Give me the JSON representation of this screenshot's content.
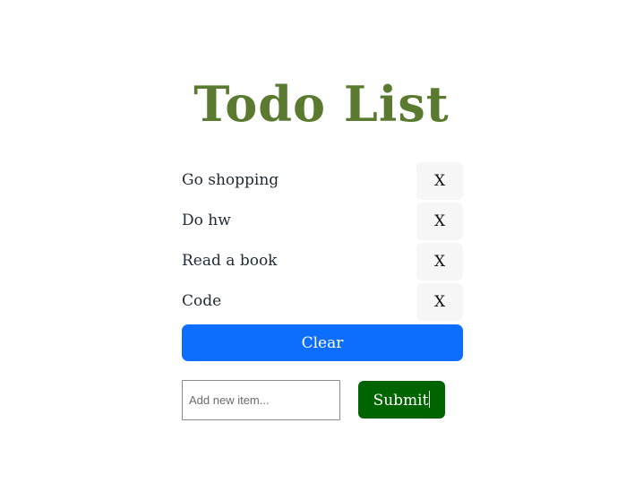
{
  "header": {
    "title": "Todo List"
  },
  "todos": [
    {
      "text": "Go shopping",
      "delete_label": "X"
    },
    {
      "text": "Do hw",
      "delete_label": "X"
    },
    {
      "text": "Read a book",
      "delete_label": "X"
    },
    {
      "text": "Code",
      "delete_label": "X"
    }
  ],
  "actions": {
    "clear_label": "Clear",
    "submit_label": "Submit"
  },
  "new_item": {
    "value": "",
    "placeholder": "Add new item..."
  },
  "colors": {
    "title": "#5a7a30",
    "clear_button": "#0d6efd",
    "submit_button": "#006400",
    "delete_button_bg": "#f6f6f6"
  }
}
